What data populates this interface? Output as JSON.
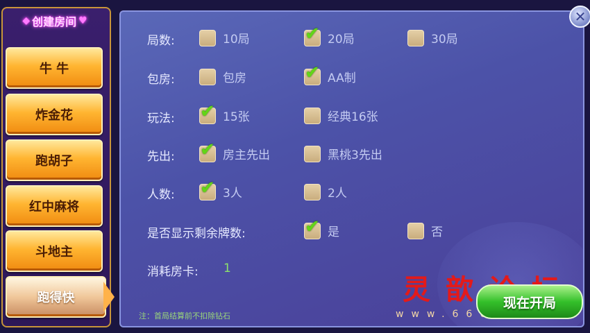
{
  "sidebar": {
    "title": "创建房间",
    "games": [
      "牛 牛",
      "炸金花",
      "跑胡子",
      "红中麻将",
      "斗地主",
      "跑得快"
    ],
    "active_game": "跑得快"
  },
  "close_label": "✕",
  "settings": {
    "rounds": {
      "label": "局数:",
      "options": [
        {
          "text": "10局",
          "checked": false
        },
        {
          "text": "20局",
          "checked": true
        },
        {
          "text": "30局",
          "checked": false
        }
      ]
    },
    "room": {
      "label": "包房:",
      "options": [
        {
          "text": "包房",
          "checked": false
        },
        {
          "text": "AA制",
          "checked": true
        }
      ]
    },
    "play": {
      "label": "玩法:",
      "options": [
        {
          "text": "15张",
          "checked": true
        },
        {
          "text": "经典16张",
          "checked": false
        }
      ]
    },
    "first": {
      "label": "先出:",
      "options": [
        {
          "text": "房主先出",
          "checked": true
        },
        {
          "text": "黑桃3先出",
          "checked": false
        }
      ]
    },
    "players": {
      "label": "人数:",
      "options": [
        {
          "text": "3人",
          "checked": true
        },
        {
          "text": "2人",
          "checked": false
        }
      ]
    },
    "show_remaining": {
      "label": "是否显示剩余牌数:",
      "options": [
        {
          "text": "是",
          "checked": true
        },
        {
          "text": "否",
          "checked": false
        }
      ]
    }
  },
  "cost": {
    "label": "消耗房卡:",
    "value": "1"
  },
  "note": "注：首局结算前不扣除钻石",
  "start_button": "现在开局",
  "watermark": {
    "text": "灵歆论坛",
    "url": "www.6665q.com"
  },
  "colors": {
    "accent_orange": "#f5a623",
    "panel_blue": "#4c52a8",
    "check_green": "#62d617",
    "start_green": "#34c02a"
  }
}
